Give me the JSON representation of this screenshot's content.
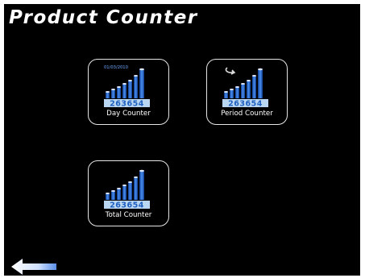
{
  "page": {
    "title": "Product Counter"
  },
  "icons": {
    "day": "day-counter-icon",
    "period": "period-counter-icon",
    "total": "total-counter-icon",
    "back": "back-arrow-icon"
  },
  "icon_date_text": "01/03/2010",
  "counter_digits": "263654",
  "tiles": {
    "day": {
      "label": "Day Counter"
    },
    "period": {
      "label": "Period Counter"
    },
    "total": {
      "label": "Total Counter"
    }
  },
  "colors": {
    "background": "#000000",
    "bar_blue": "#2f6fd6",
    "tile_border": "#e6e6e6",
    "text": "#ffffff"
  }
}
